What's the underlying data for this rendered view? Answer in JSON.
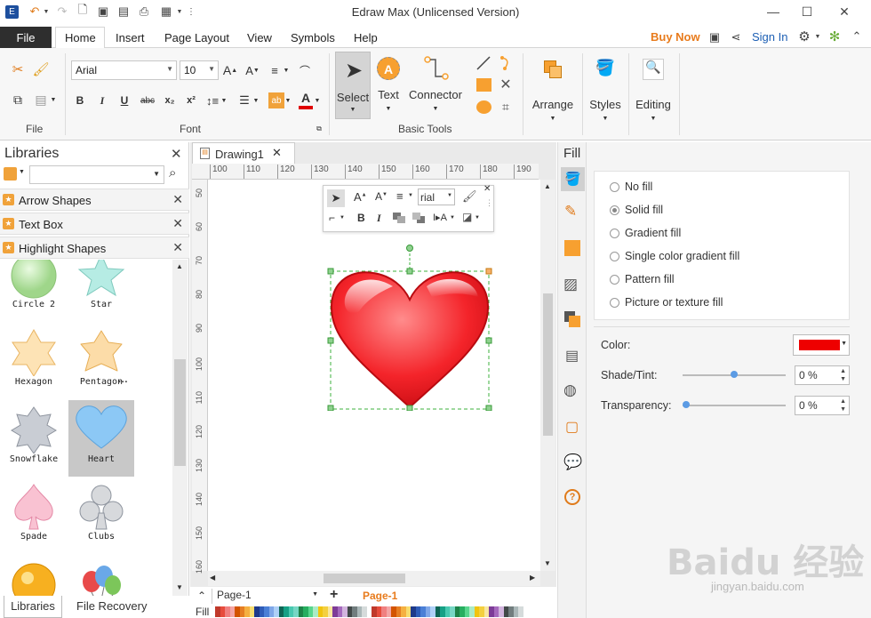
{
  "title": "Edraw Max (Unlicensed Version)",
  "menu": {
    "file": "File",
    "tabs": [
      "Home",
      "Insert",
      "Page Layout",
      "View",
      "Symbols",
      "Help"
    ],
    "buy_now": "Buy Now",
    "sign_in": "Sign In"
  },
  "ribbon": {
    "groups": {
      "file": "File",
      "font": "Font",
      "basic_tools": "Basic Tools"
    },
    "font_name": "Arial",
    "font_size": "10",
    "select": "Select",
    "text": "Text",
    "connector": "Connector",
    "arrange": "Arrange",
    "styles": "Styles",
    "editing": "Editing",
    "font_color": "#e00000"
  },
  "libraries": {
    "title": "Libraries",
    "categories": [
      "Arrow Shapes",
      "Text Box",
      "Highlight Shapes"
    ],
    "shapes": [
      "Circle 2",
      "Star",
      "Hexagon",
      "Pentagon",
      "Snowflake",
      "Heart",
      "Spade",
      "Clubs",
      "",
      ""
    ],
    "selected": "Heart"
  },
  "bottom_tabs": {
    "libraries": "Libraries",
    "file_recovery": "File Recovery"
  },
  "document": {
    "tab": "Drawing1",
    "ruler_h": [
      "100",
      "110",
      "120",
      "130",
      "140",
      "150",
      "160",
      "170",
      "180",
      "190"
    ],
    "ruler_v": [
      "50",
      "60",
      "70",
      "80",
      "90",
      "100",
      "110",
      "120",
      "130",
      "140",
      "150",
      "160"
    ],
    "float_font": "rial",
    "page_select": "Page-1",
    "page_tab": "Page-1",
    "fill_label": "Fill"
  },
  "fill_panel": {
    "title": "Fill",
    "options": [
      "No fill",
      "Solid fill",
      "Gradient fill",
      "Single color gradient fill",
      "Pattern fill",
      "Picture or texture fill"
    ],
    "selected_option": "Solid fill",
    "color_label": "Color:",
    "color_value": "#ee0000",
    "shade_label": "Shade/Tint:",
    "shade_value": "0 %",
    "shade_level": 0.5,
    "transparency_label": "Transparency:",
    "transparency_value": "0 %",
    "transparency_level": 0
  },
  "colors": {
    "accent": "#e87b1c",
    "link": "#1d5fb4",
    "shape_orange": "#f7a030"
  },
  "watermark": {
    "brand": "Baidu 经验",
    "url": "jingyan.baidu.com"
  }
}
